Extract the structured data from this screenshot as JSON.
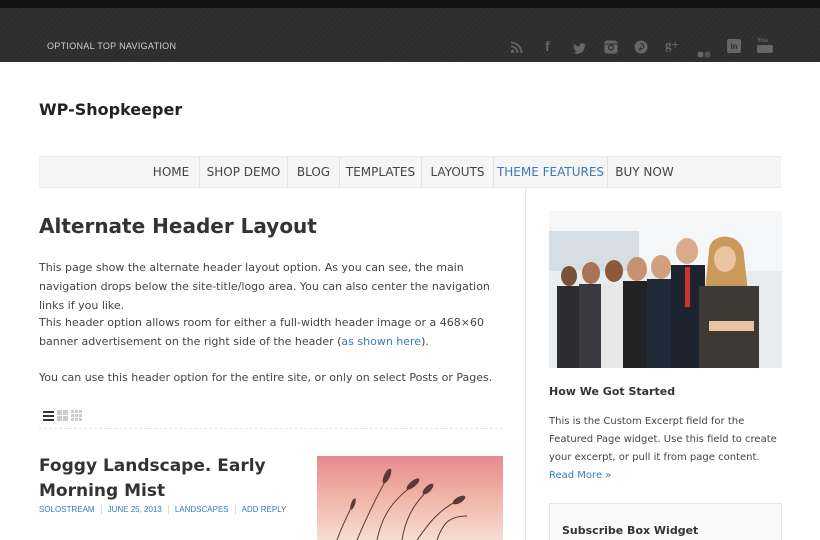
{
  "top_navigation": {
    "label": "OPTIONAL TOP NAVIGATION",
    "social_icons": [
      "rss-icon",
      "facebook-icon",
      "twitter-icon",
      "instagram-icon",
      "pinterest-icon",
      "google-plus-icon",
      "flickr-icon",
      "linkedin-icon",
      "youtube-icon"
    ],
    "social_glyphs": {
      "facebook": "f",
      "google_plus": "g+",
      "linkedin": "in",
      "youtube": "You"
    }
  },
  "site": {
    "title": "WP-Shopkeeper"
  },
  "main_nav": {
    "items": [
      "HOME",
      "SHOP DEMO",
      "BLOG",
      "TEMPLATES",
      "LAYOUTS",
      "THEME FEATURES",
      "BUY NOW"
    ],
    "active": "THEME FEATURES"
  },
  "page": {
    "title": "Alternate Header Layout",
    "para1": "This page show the alternate header layout option. As you can see, the main navigation drops below the site-title/logo area. You can also center the navigation links if you like.",
    "para2_before": "This header option allows room for either a full-width header image or a 468×60 banner advertisement on the right side of the header (",
    "para2_link": "as shown here",
    "para2_after": ").",
    "para3": "You can use this header option for the entire site, or only on select Posts or Pages."
  },
  "post": {
    "title": "Foggy Landscape. Early Morning Mist",
    "meta": [
      "SOLOSTREAM",
      "JUNE 25, 2013",
      "LANDSCAPES",
      "ADD REPLY"
    ]
  },
  "sidebar": {
    "widget_title": "How We Got Started",
    "widget_text": "This is the Custom Excerpt field for the Featured Page widget. Use this field to create your excerpt, or pull it from page content.",
    "read_more": "Read More »",
    "subscribe_title": "Subscribe Box Widget"
  },
  "colors": {
    "topbar": "#2e2e2e",
    "link": "#3a7ab8",
    "nav_bg": "#f5f5f5"
  }
}
